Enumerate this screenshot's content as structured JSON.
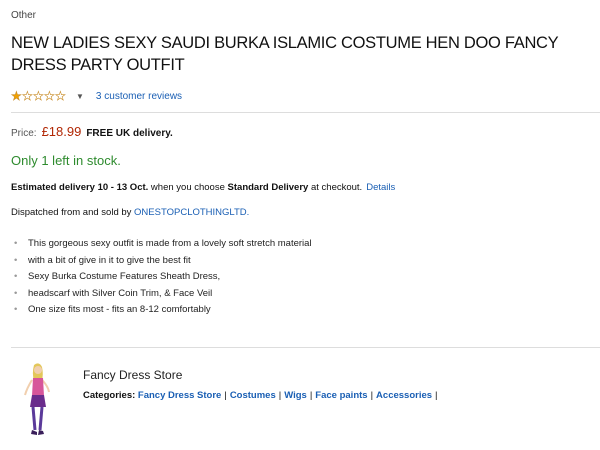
{
  "product": {
    "category": "Other",
    "title": "NEW LADIES SEXY SAUDI BURKA ISLAMIC COSTUME HEN DOO FANCY DRESS PARTY OUTFIT",
    "rating": 1,
    "rating_max": 5,
    "reviews_link": "3 customer reviews",
    "price_label": "Price:",
    "price_value": "£18.99",
    "free_delivery": "FREE UK delivery.",
    "stock": "Only 1 left in stock.",
    "delivery_prefix": "Estimated delivery 10 - 13 Oct.",
    "delivery_mid": " when you choose ",
    "delivery_bold": "Standard Delivery",
    "delivery_suffix": " at checkout.",
    "details_link": "Details",
    "dispatch_prefix": "Dispatched from and sold by ",
    "seller": "ONESTOPCLOTHINGLTD.",
    "features": [
      "This gorgeous sexy outfit is made from a lovely soft stretch material",
      "with a bit of give in it to give the best fit",
      "Sexy Burka Costume Features Sheath Dress,",
      "headscarf with Silver Coin Trim, & Face Veil",
      "One size fits most - fits an 8-12 comfortably"
    ]
  },
  "store": {
    "name": "Fancy Dress Store",
    "categories_label": "Categories:",
    "categories": [
      "Fancy Dress Store",
      "Costumes",
      "Wigs",
      "Face paints",
      "Accessories"
    ],
    "separator": "|"
  },
  "colors": {
    "link": "#1a5fb4",
    "price": "#b12704",
    "stock": "#2e8b2e",
    "star": "#f2a100"
  }
}
